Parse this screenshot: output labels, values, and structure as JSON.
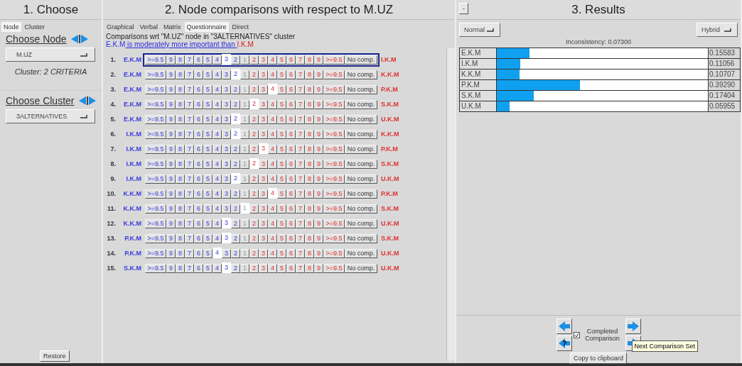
{
  "choose": {
    "title": "1. Choose",
    "tabs": [
      {
        "label": "Node",
        "selected": true
      },
      {
        "label": "Cluster",
        "selected": false
      }
    ],
    "node_heading": "Choose Node",
    "node_dropdown": "M.UZ",
    "cluster_info": "Cluster: 2 CRITERIA",
    "cluster_heading": "Choose Cluster",
    "cluster_dropdown": "3ALTERNATIVES",
    "restore_button": "Restore"
  },
  "comparisons": {
    "title": "2. Node comparisons with respect to M.UZ",
    "tabs": [
      {
        "label": "Graphical",
        "selected": false
      },
      {
        "label": "Verbal",
        "selected": false
      },
      {
        "label": "Matrix",
        "selected": false
      },
      {
        "label": "Questionnaire",
        "selected": true
      },
      {
        "label": "Direct",
        "selected": false
      }
    ],
    "caption": "Comparisons wrt \"M.UZ\" node in \"3ALTERNATIVES\" cluster",
    "verbal": {
      "left": "E.K.M",
      "phrase": " is moderately more important than ",
      "right": "I.K.M"
    },
    "rows": [
      {
        "number": "1.",
        "left": "E.K.M",
        "right": "I.K.M",
        "focused": true,
        "no_comparison": "No comp.",
        "cells": [
          {
            "label": ">=9.5",
            "selected": false
          },
          {
            "label": "9",
            "selected": false
          },
          {
            "label": "8",
            "selected": false
          },
          {
            "label": "7",
            "selected": false
          },
          {
            "label": "6",
            "selected": false
          },
          {
            "label": "5",
            "selected": false
          },
          {
            "label": "4",
            "selected": false
          },
          {
            "label": "3",
            "selected": true
          },
          {
            "label": "2",
            "selected": false
          },
          {
            "label": "1",
            "selected": false
          },
          {
            "label": "2",
            "selected": false
          },
          {
            "label": "3",
            "selected": false
          },
          {
            "label": "4",
            "selected": false
          },
          {
            "label": "5",
            "selected": false
          },
          {
            "label": "6",
            "selected": false
          },
          {
            "label": "7",
            "selected": false
          },
          {
            "label": "8",
            "selected": false
          },
          {
            "label": "9",
            "selected": false
          },
          {
            "label": ">=9.5",
            "selected": false
          }
        ]
      },
      {
        "number": "2.",
        "left": "E.K.M",
        "right": "K.K.M",
        "focused": false,
        "no_comparison": "No comp.",
        "cells": [
          {
            "label": ">=9.5",
            "selected": false
          },
          {
            "label": "9",
            "selected": false
          },
          {
            "label": "8",
            "selected": false
          },
          {
            "label": "7",
            "selected": false
          },
          {
            "label": "6",
            "selected": false
          },
          {
            "label": "5",
            "selected": false
          },
          {
            "label": "4",
            "selected": false
          },
          {
            "label": "3",
            "selected": false
          },
          {
            "label": "2",
            "selected": true
          },
          {
            "label": "1",
            "selected": false
          },
          {
            "label": "2",
            "selected": false
          },
          {
            "label": "3",
            "selected": false
          },
          {
            "label": "4",
            "selected": false
          },
          {
            "label": "5",
            "selected": false
          },
          {
            "label": "6",
            "selected": false
          },
          {
            "label": "7",
            "selected": false
          },
          {
            "label": "8",
            "selected": false
          },
          {
            "label": "9",
            "selected": false
          },
          {
            "label": ">=9.5",
            "selected": false
          }
        ]
      },
      {
        "number": "3.",
        "left": "E.K.M",
        "right": "P.K.M",
        "focused": false,
        "no_comparison": "No comp.",
        "cells": [
          {
            "label": ">=9.5",
            "selected": false
          },
          {
            "label": "9",
            "selected": false
          },
          {
            "label": "8",
            "selected": false
          },
          {
            "label": "7",
            "selected": false
          },
          {
            "label": "6",
            "selected": false
          },
          {
            "label": "5",
            "selected": false
          },
          {
            "label": "4",
            "selected": false
          },
          {
            "label": "3",
            "selected": false
          },
          {
            "label": "2",
            "selected": false
          },
          {
            "label": "1",
            "selected": false
          },
          {
            "label": "2",
            "selected": false
          },
          {
            "label": "3",
            "selected": false
          },
          {
            "label": "4",
            "selected": true
          },
          {
            "label": "5",
            "selected": false
          },
          {
            "label": "6",
            "selected": false
          },
          {
            "label": "7",
            "selected": false
          },
          {
            "label": "8",
            "selected": false
          },
          {
            "label": "9",
            "selected": false
          },
          {
            "label": ">=9.5",
            "selected": false
          }
        ]
      },
      {
        "number": "4.",
        "left": "E.K.M",
        "right": "S.K.M",
        "focused": false,
        "no_comparison": "No comp.",
        "cells": [
          {
            "label": ">=9.5",
            "selected": false
          },
          {
            "label": "9",
            "selected": false
          },
          {
            "label": "8",
            "selected": false
          },
          {
            "label": "7",
            "selected": false
          },
          {
            "label": "6",
            "selected": false
          },
          {
            "label": "5",
            "selected": false
          },
          {
            "label": "4",
            "selected": false
          },
          {
            "label": "3",
            "selected": false
          },
          {
            "label": "2",
            "selected": false
          },
          {
            "label": "1",
            "selected": false
          },
          {
            "label": "2",
            "selected": true
          },
          {
            "label": "3",
            "selected": false
          },
          {
            "label": "4",
            "selected": false
          },
          {
            "label": "5",
            "selected": false
          },
          {
            "label": "6",
            "selected": false
          },
          {
            "label": "7",
            "selected": false
          },
          {
            "label": "8",
            "selected": false
          },
          {
            "label": "9",
            "selected": false
          },
          {
            "label": ">=9.5",
            "selected": false
          }
        ]
      },
      {
        "number": "5.",
        "left": "E.K.M",
        "right": "U.K.M",
        "focused": false,
        "no_comparison": "No comp.",
        "cells": [
          {
            "label": ">=9.5",
            "selected": false
          },
          {
            "label": "9",
            "selected": false
          },
          {
            "label": "8",
            "selected": false
          },
          {
            "label": "7",
            "selected": false
          },
          {
            "label": "6",
            "selected": false
          },
          {
            "label": "5",
            "selected": false
          },
          {
            "label": "4",
            "selected": false
          },
          {
            "label": "3",
            "selected": false
          },
          {
            "label": "2",
            "selected": true
          },
          {
            "label": "1",
            "selected": false
          },
          {
            "label": "2",
            "selected": false
          },
          {
            "label": "3",
            "selected": false
          },
          {
            "label": "4",
            "selected": false
          },
          {
            "label": "5",
            "selected": false
          },
          {
            "label": "6",
            "selected": false
          },
          {
            "label": "7",
            "selected": false
          },
          {
            "label": "8",
            "selected": false
          },
          {
            "label": "9",
            "selected": false
          },
          {
            "label": ">=9.5",
            "selected": false
          }
        ]
      },
      {
        "number": "6.",
        "left": "I.K.M",
        "right": "K.K.M",
        "focused": false,
        "no_comparison": "No comp.",
        "cells": [
          {
            "label": ">=9.5",
            "selected": false
          },
          {
            "label": "9",
            "selected": false
          },
          {
            "label": "8",
            "selected": false
          },
          {
            "label": "7",
            "selected": false
          },
          {
            "label": "6",
            "selected": false
          },
          {
            "label": "5",
            "selected": false
          },
          {
            "label": "4",
            "selected": false
          },
          {
            "label": "3",
            "selected": false
          },
          {
            "label": "2",
            "selected": true
          },
          {
            "label": "1",
            "selected": false
          },
          {
            "label": "2",
            "selected": false
          },
          {
            "label": "3",
            "selected": false
          },
          {
            "label": "4",
            "selected": false
          },
          {
            "label": "5",
            "selected": false
          },
          {
            "label": "6",
            "selected": false
          },
          {
            "label": "7",
            "selected": false
          },
          {
            "label": "8",
            "selected": false
          },
          {
            "label": "9",
            "selected": false
          },
          {
            "label": ">=9.5",
            "selected": false
          }
        ]
      },
      {
        "number": "7.",
        "left": "I.K.M",
        "right": "P.K.M",
        "focused": false,
        "no_comparison": "No comp.",
        "cells": [
          {
            "label": ">=9.5",
            "selected": false
          },
          {
            "label": "9",
            "selected": false
          },
          {
            "label": "8",
            "selected": false
          },
          {
            "label": "7",
            "selected": false
          },
          {
            "label": "6",
            "selected": false
          },
          {
            "label": "5",
            "selected": false
          },
          {
            "label": "4",
            "selected": false
          },
          {
            "label": "3",
            "selected": false
          },
          {
            "label": "2",
            "selected": false
          },
          {
            "label": "1",
            "selected": false
          },
          {
            "label": "2",
            "selected": false
          },
          {
            "label": "3",
            "selected": true
          },
          {
            "label": "4",
            "selected": false
          },
          {
            "label": "5",
            "selected": false
          },
          {
            "label": "6",
            "selected": false
          },
          {
            "label": "7",
            "selected": false
          },
          {
            "label": "8",
            "selected": false
          },
          {
            "label": "9",
            "selected": false
          },
          {
            "label": ">=9.5",
            "selected": false
          }
        ]
      },
      {
        "number": "8.",
        "left": "I.K.M",
        "right": "S.K.M",
        "focused": false,
        "no_comparison": "No comp.",
        "cells": [
          {
            "label": ">=9.5",
            "selected": false
          },
          {
            "label": "9",
            "selected": false
          },
          {
            "label": "8",
            "selected": false
          },
          {
            "label": "7",
            "selected": false
          },
          {
            "label": "6",
            "selected": false
          },
          {
            "label": "5",
            "selected": false
          },
          {
            "label": "4",
            "selected": false
          },
          {
            "label": "3",
            "selected": false
          },
          {
            "label": "2",
            "selected": false
          },
          {
            "label": "1",
            "selected": false
          },
          {
            "label": "2",
            "selected": true
          },
          {
            "label": "3",
            "selected": false
          },
          {
            "label": "4",
            "selected": false
          },
          {
            "label": "5",
            "selected": false
          },
          {
            "label": "6",
            "selected": false
          },
          {
            "label": "7",
            "selected": false
          },
          {
            "label": "8",
            "selected": false
          },
          {
            "label": "9",
            "selected": false
          },
          {
            "label": ">=9.5",
            "selected": false
          }
        ]
      },
      {
        "number": "9.",
        "left": "I.K.M",
        "right": "U.K.M",
        "focused": false,
        "no_comparison": "No comp.",
        "cells": [
          {
            "label": ">=9.5",
            "selected": false
          },
          {
            "label": "9",
            "selected": false
          },
          {
            "label": "8",
            "selected": false
          },
          {
            "label": "7",
            "selected": false
          },
          {
            "label": "6",
            "selected": false
          },
          {
            "label": "5",
            "selected": false
          },
          {
            "label": "4",
            "selected": false
          },
          {
            "label": "3",
            "selected": false
          },
          {
            "label": "2",
            "selected": true
          },
          {
            "label": "1",
            "selected": false
          },
          {
            "label": "2",
            "selected": false
          },
          {
            "label": "3",
            "selected": false
          },
          {
            "label": "4",
            "selected": false
          },
          {
            "label": "5",
            "selected": false
          },
          {
            "label": "6",
            "selected": false
          },
          {
            "label": "7",
            "selected": false
          },
          {
            "label": "8",
            "selected": false
          },
          {
            "label": "9",
            "selected": false
          },
          {
            "label": ">=9.5",
            "selected": false
          }
        ]
      },
      {
        "number": "10.",
        "left": "K.K.M",
        "right": "P.K.M",
        "focused": false,
        "no_comparison": "No comp.",
        "cells": [
          {
            "label": ">=9.5",
            "selected": false
          },
          {
            "label": "9",
            "selected": false
          },
          {
            "label": "8",
            "selected": false
          },
          {
            "label": "7",
            "selected": false
          },
          {
            "label": "6",
            "selected": false
          },
          {
            "label": "5",
            "selected": false
          },
          {
            "label": "4",
            "selected": false
          },
          {
            "label": "3",
            "selected": false
          },
          {
            "label": "2",
            "selected": false
          },
          {
            "label": "1",
            "selected": false
          },
          {
            "label": "2",
            "selected": false
          },
          {
            "label": "3",
            "selected": false
          },
          {
            "label": "4",
            "selected": true
          },
          {
            "label": "5",
            "selected": false
          },
          {
            "label": "6",
            "selected": false
          },
          {
            "label": "7",
            "selected": false
          },
          {
            "label": "8",
            "selected": false
          },
          {
            "label": "9",
            "selected": false
          },
          {
            "label": ">=9.5",
            "selected": false
          }
        ]
      },
      {
        "number": "11.",
        "left": "K.K.M",
        "right": "S.K.M",
        "focused": false,
        "no_comparison": "No comp.",
        "cells": [
          {
            "label": ">=9.5",
            "selected": false
          },
          {
            "label": "9",
            "selected": false
          },
          {
            "label": "8",
            "selected": false
          },
          {
            "label": "7",
            "selected": false
          },
          {
            "label": "6",
            "selected": false
          },
          {
            "label": "5",
            "selected": false
          },
          {
            "label": "4",
            "selected": false
          },
          {
            "label": "3",
            "selected": false
          },
          {
            "label": "2",
            "selected": false
          },
          {
            "label": "1",
            "selected": true
          },
          {
            "label": "2",
            "selected": false
          },
          {
            "label": "3",
            "selected": false
          },
          {
            "label": "4",
            "selected": false
          },
          {
            "label": "5",
            "selected": false
          },
          {
            "label": "6",
            "selected": false
          },
          {
            "label": "7",
            "selected": false
          },
          {
            "label": "8",
            "selected": false
          },
          {
            "label": "9",
            "selected": false
          },
          {
            "label": ">=9.5",
            "selected": false
          }
        ]
      },
      {
        "number": "12.",
        "left": "K.K.M",
        "right": "U.K.M",
        "focused": false,
        "no_comparison": "No comp.",
        "cells": [
          {
            "label": ">=9.5",
            "selected": false
          },
          {
            "label": "9",
            "selected": false
          },
          {
            "label": "8",
            "selected": false
          },
          {
            "label": "7",
            "selected": false
          },
          {
            "label": "6",
            "selected": false
          },
          {
            "label": "5",
            "selected": false
          },
          {
            "label": "4",
            "selected": false
          },
          {
            "label": "3",
            "selected": true
          },
          {
            "label": "2",
            "selected": false
          },
          {
            "label": "1",
            "selected": false
          },
          {
            "label": "2",
            "selected": false
          },
          {
            "label": "3",
            "selected": false
          },
          {
            "label": "4",
            "selected": false
          },
          {
            "label": "5",
            "selected": false
          },
          {
            "label": "6",
            "selected": false
          },
          {
            "label": "7",
            "selected": false
          },
          {
            "label": "8",
            "selected": false
          },
          {
            "label": "9",
            "selected": false
          },
          {
            "label": ">=9.5",
            "selected": false
          }
        ]
      },
      {
        "number": "13.",
        "left": "P.K.M",
        "right": "S.K.M",
        "focused": false,
        "no_comparison": "No comp.",
        "cells": [
          {
            "label": ">=9.5",
            "selected": false
          },
          {
            "label": "9",
            "selected": false
          },
          {
            "label": "8",
            "selected": false
          },
          {
            "label": "7",
            "selected": false
          },
          {
            "label": "6",
            "selected": false
          },
          {
            "label": "5",
            "selected": false
          },
          {
            "label": "4",
            "selected": false
          },
          {
            "label": "3",
            "selected": true
          },
          {
            "label": "2",
            "selected": false
          },
          {
            "label": "1",
            "selected": false
          },
          {
            "label": "2",
            "selected": false
          },
          {
            "label": "3",
            "selected": false
          },
          {
            "label": "4",
            "selected": false
          },
          {
            "label": "5",
            "selected": false
          },
          {
            "label": "6",
            "selected": false
          },
          {
            "label": "7",
            "selected": false
          },
          {
            "label": "8",
            "selected": false
          },
          {
            "label": "9",
            "selected": false
          },
          {
            "label": ">=9.5",
            "selected": false
          }
        ]
      },
      {
        "number": "14.",
        "left": "P.K.M",
        "right": "U.K.M",
        "focused": false,
        "no_comparison": "No comp.",
        "cells": [
          {
            "label": ">=9.5",
            "selected": false
          },
          {
            "label": "9",
            "selected": false
          },
          {
            "label": "8",
            "selected": false
          },
          {
            "label": "7",
            "selected": false
          },
          {
            "label": "6",
            "selected": false
          },
          {
            "label": "5",
            "selected": false
          },
          {
            "label": "4",
            "selected": true
          },
          {
            "label": "3",
            "selected": false
          },
          {
            "label": "2",
            "selected": false
          },
          {
            "label": "1",
            "selected": false
          },
          {
            "label": "2",
            "selected": false
          },
          {
            "label": "3",
            "selected": false
          },
          {
            "label": "4",
            "selected": false
          },
          {
            "label": "5",
            "selected": false
          },
          {
            "label": "6",
            "selected": false
          },
          {
            "label": "7",
            "selected": false
          },
          {
            "label": "8",
            "selected": false
          },
          {
            "label": "9",
            "selected": false
          },
          {
            "label": ">=9.5",
            "selected": false
          }
        ]
      },
      {
        "number": "15.",
        "left": "S.K.M",
        "right": "U.K.M",
        "focused": false,
        "no_comparison": "No comp.",
        "cells": [
          {
            "label": ">=9.5",
            "selected": false
          },
          {
            "label": "9",
            "selected": false
          },
          {
            "label": "8",
            "selected": false
          },
          {
            "label": "7",
            "selected": false
          },
          {
            "label": "6",
            "selected": false
          },
          {
            "label": "5",
            "selected": false
          },
          {
            "label": "4",
            "selected": false
          },
          {
            "label": "3",
            "selected": true
          },
          {
            "label": "2",
            "selected": false
          },
          {
            "label": "1",
            "selected": false
          },
          {
            "label": "2",
            "selected": false
          },
          {
            "label": "3",
            "selected": false
          },
          {
            "label": "4",
            "selected": false
          },
          {
            "label": "5",
            "selected": false
          },
          {
            "label": "6",
            "selected": false
          },
          {
            "label": "7",
            "selected": false
          },
          {
            "label": "8",
            "selected": false
          },
          {
            "label": "9",
            "selected": false
          },
          {
            "label": ">=9.5",
            "selected": false
          }
        ]
      }
    ]
  },
  "results": {
    "collapse_button": "-",
    "title": "3. Results",
    "mode_dropdown": "Normal",
    "method_dropdown": "Hybrid",
    "inconsistency": "Inconsistency: 0.07300",
    "priorities": [
      {
        "label": "E.K.M",
        "level": 0.15583,
        "value": "0.15583"
      },
      {
        "label": "I.K.M",
        "level": 0.11056,
        "value": "0.11056"
      },
      {
        "label": "K.K.M",
        "level": 0.10707,
        "value": "0.10707"
      },
      {
        "label": "P.K.M",
        "level": 0.3929,
        "value": "0.39290"
      },
      {
        "label": "S.K.M",
        "level": 0.17404,
        "value": "0.17404"
      },
      {
        "label": "U.K.M",
        "level": 0.05955,
        "value": "0.05955"
      }
    ],
    "completed": {
      "label": "Completed Comparison",
      "checked": true
    },
    "tooltip": "Next Comparison Set",
    "copy_button": "Copy to clipboard"
  }
}
